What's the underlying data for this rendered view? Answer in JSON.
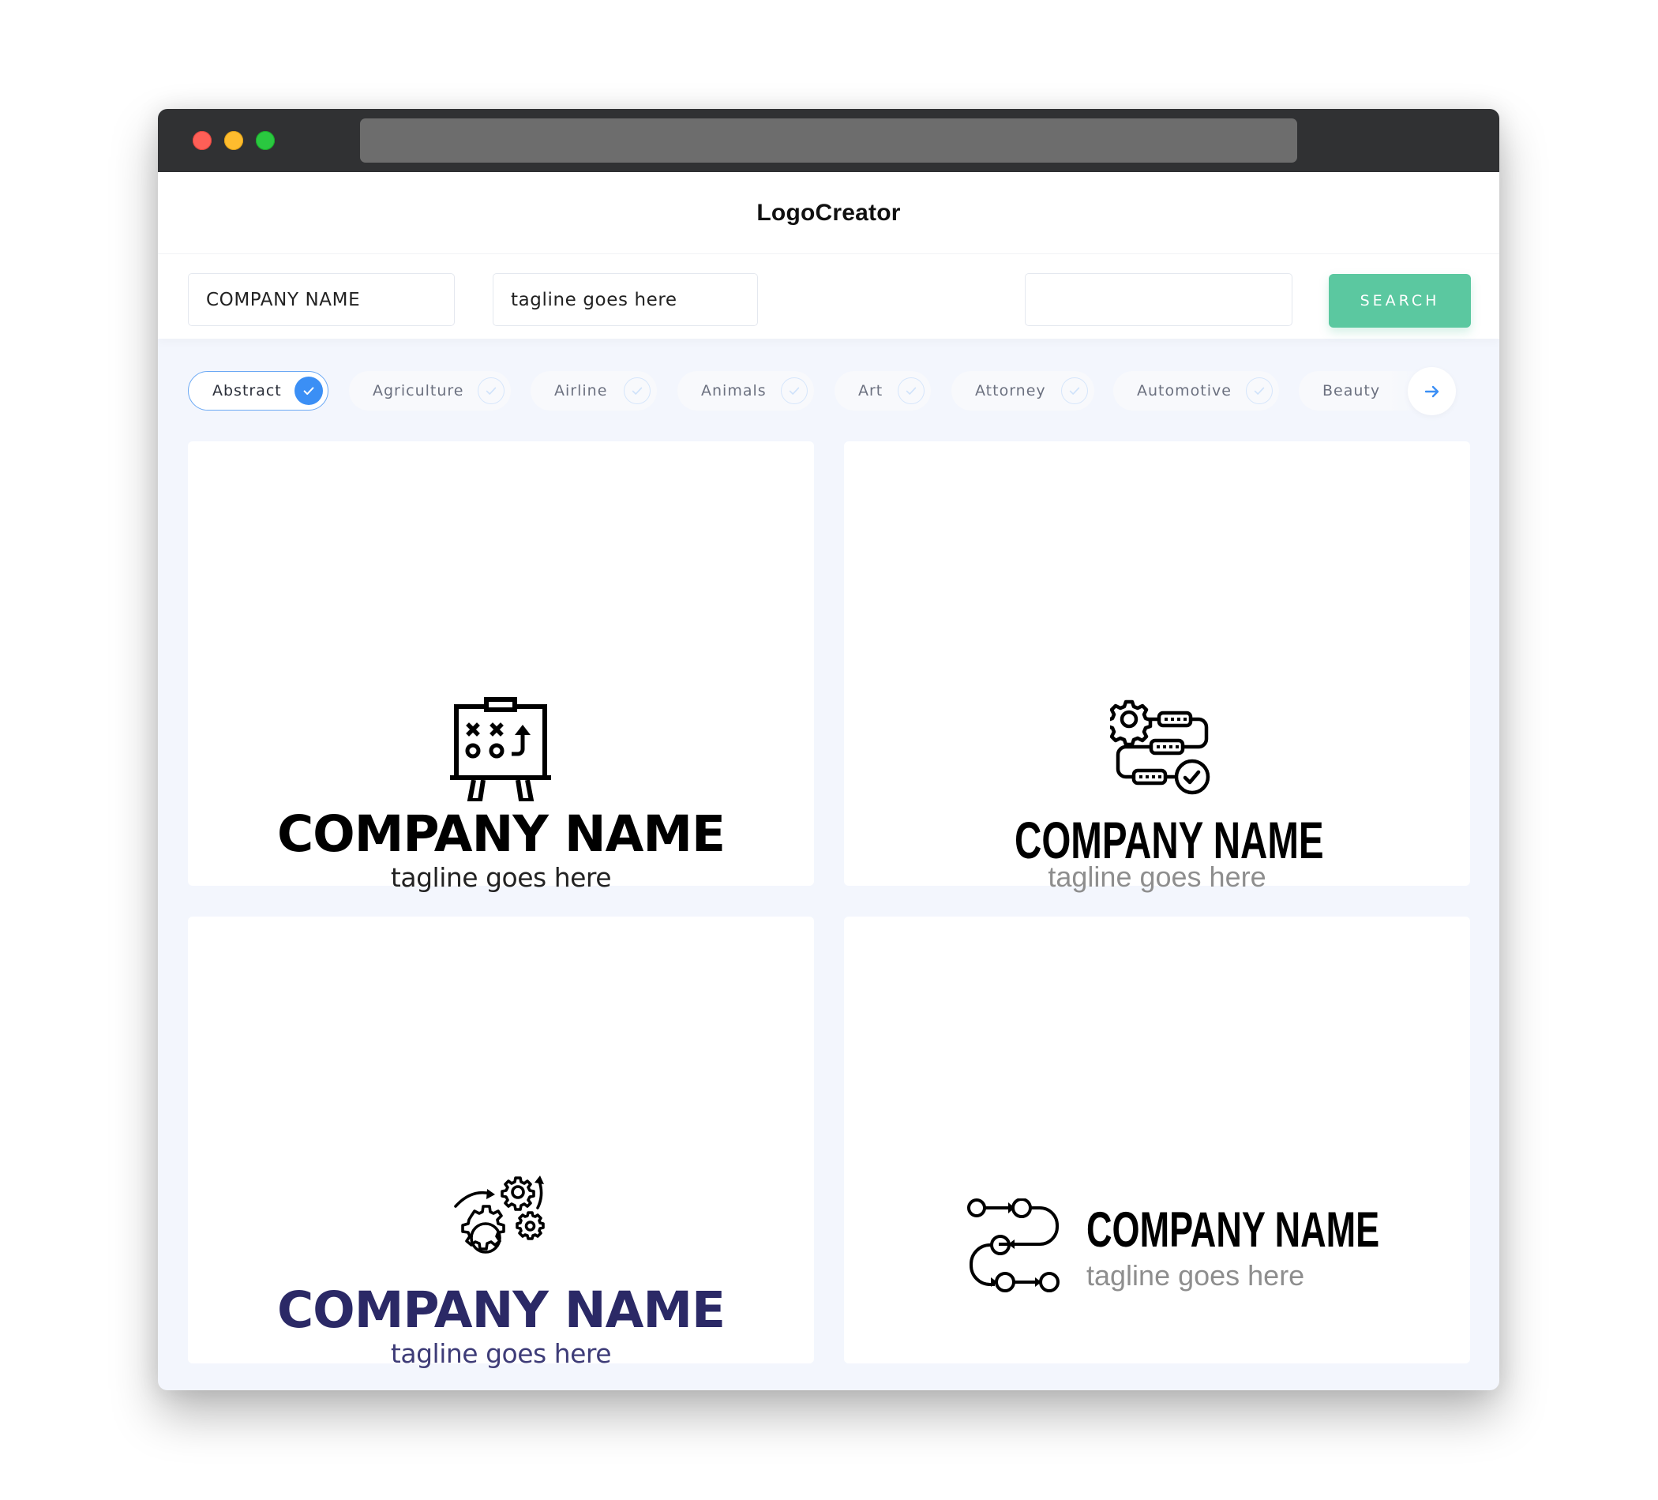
{
  "browser": {
    "traffic_lights": [
      "close",
      "minimize",
      "maximize"
    ],
    "url": ""
  },
  "header": {
    "title": "LogoCreator"
  },
  "toolbar": {
    "company_value": "COMPANY NAME",
    "tagline_value": "tagline goes here",
    "search_value": "",
    "search_label": "SEARCH"
  },
  "categories": {
    "items": [
      {
        "label": "Abstract",
        "selected": true
      },
      {
        "label": "Agriculture",
        "selected": false
      },
      {
        "label": "Airline",
        "selected": false
      },
      {
        "label": "Animals",
        "selected": false
      },
      {
        "label": "Art",
        "selected": false
      },
      {
        "label": "Attorney",
        "selected": false
      },
      {
        "label": "Automotive",
        "selected": false
      },
      {
        "label": "Beauty",
        "selected": false
      }
    ],
    "next_icon": "arrow-right-icon"
  },
  "logos": [
    {
      "icon": "strategy-board-icon",
      "company": "COMPANY NAME",
      "tagline": "tagline goes here",
      "color": "#000000",
      "tagline_color": "#222222"
    },
    {
      "icon": "gear-workflow-icon",
      "company": "COMPANY NAME",
      "tagline": "tagline goes here",
      "color": "#000000",
      "tagline_color": "#8e8e8e"
    },
    {
      "icon": "gears-process-icon",
      "company": "COMPANY NAME",
      "tagline": "tagline goes here",
      "color": "#2b2966",
      "tagline_color": "#3e3c78"
    },
    {
      "icon": "flow-path-icon",
      "company": "COMPANY NAME",
      "tagline": "tagline goes here",
      "color": "#000000",
      "tagline_color": "#8e8e8e"
    }
  ],
  "colors": {
    "accent_blue": "#3b8ff5",
    "search_green": "#5bc8a0",
    "titlebar": "#303133",
    "page_bg": "#f3f6fd"
  }
}
